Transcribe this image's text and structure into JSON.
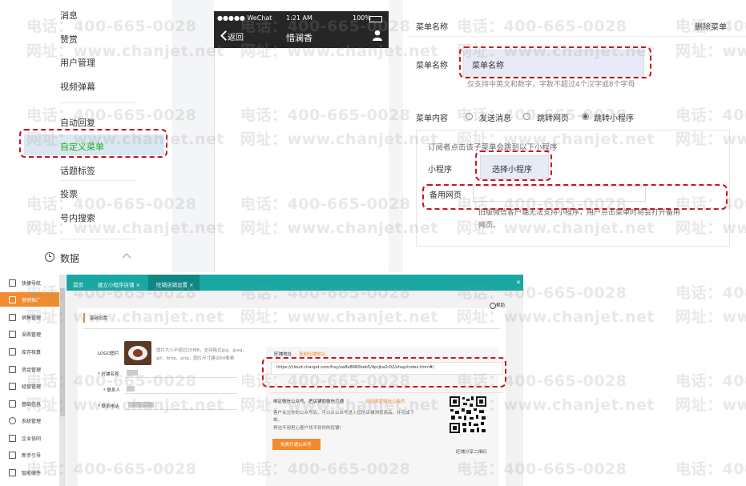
{
  "sidebar": {
    "items": [
      {
        "label": "消息"
      },
      {
        "label": "赞赏"
      },
      {
        "label": "用户管理"
      },
      {
        "label": "视频弹幕"
      },
      {
        "label": "自动回复"
      },
      {
        "label": "自定义菜单"
      },
      {
        "label": "话题标签"
      },
      {
        "label": "投票"
      },
      {
        "label": "号内搜索"
      }
    ],
    "data_section": "数据"
  },
  "phone": {
    "carrier": "●●●●● WeChat",
    "time": "1:21 AM",
    "battery": "100%",
    "back_label": "返回",
    "title": "惜澜香"
  },
  "editor": {
    "menu_name_header": "菜单名称",
    "delete_label": "删除菜单",
    "menu_name_label": "菜单名称",
    "menu_name_value": "菜单名称",
    "menu_name_hint": "仅支持中英文和数字，字数不超过4个汉字或8个字母",
    "menu_content_label": "菜单内容",
    "radio_options": [
      {
        "label": "发送消息",
        "selected": false
      },
      {
        "label": "跳转网页",
        "selected": false
      },
      {
        "label": "跳转小程序",
        "selected": true
      }
    ],
    "jump_desc": "订阅者点击该子菜单会跳到以下小程序",
    "mini_program_label": "小程序",
    "choose_mini_program": "选择小程序",
    "backup_url_label": "备用网页",
    "backup_hint_1": "旧版微信客户端无法支持小程序，用户点击菜单时将会打开备用",
    "backup_hint_2": "网页。"
  },
  "bottom": {
    "sidebar_items": [
      {
        "label": "快捷导航"
      },
      {
        "label": "营销推广"
      },
      {
        "label": "销售管理"
      },
      {
        "label": "采购管理"
      },
      {
        "label": "库存核算"
      },
      {
        "label": "资金管理"
      },
      {
        "label": "经营管理"
      },
      {
        "label": "基础信息"
      },
      {
        "label": "系统管理"
      },
      {
        "label": "企业协同"
      },
      {
        "label": "新手引导"
      },
      {
        "label": "智能硬件"
      }
    ],
    "tabs": [
      {
        "label": "首页"
      },
      {
        "label": "建立小程序店铺 ×"
      },
      {
        "label": "旺铺店铺设置 ×"
      }
    ],
    "help": "帮助",
    "section_title": "基础设置",
    "logo_label": "LOGO图片",
    "logo_hint_1": "图片大小不超过20MB，支持格式jpg、jpeg、",
    "logo_hint_2": "gif、bmp、png，图片尺寸建议64像素",
    "shop_name_label": "* 旺铺名称",
    "contact_label": "* 联系人",
    "phone_label": "* 联系电话",
    "shop_url_label": "旺铺地址",
    "shop_url_link": "复制旺铺地址",
    "shop_url": "https://cloud.chanjet.com/hsy/ua8s8680keb5/4prjka2r02/shop/index.html#/",
    "wechat_bind_title": "绑定微信公众号，把店铺和微信打通",
    "wechat_bind_link": "如何绑定微信公众号",
    "wechat_desc_1": "客户关注你的公众号后，可以从公众号进入您的店铺浏览商品，并完成下",
    "wechat_desc_2": "单。",
    "wechat_desc_3": "再也不用担心客户找不到你的旺铺！",
    "open_button": "免费开通公众号",
    "qr_caption": "旺铺分享二维码"
  },
  "watermark": {
    "phone": "电话：400-665-0028",
    "site": "网址：www.chanjet.net"
  },
  "colors": {
    "highlight": "#c8161d",
    "wechat_green": "#1aad19",
    "teal": "#18a7a3",
    "orange": "#f28b2e"
  }
}
